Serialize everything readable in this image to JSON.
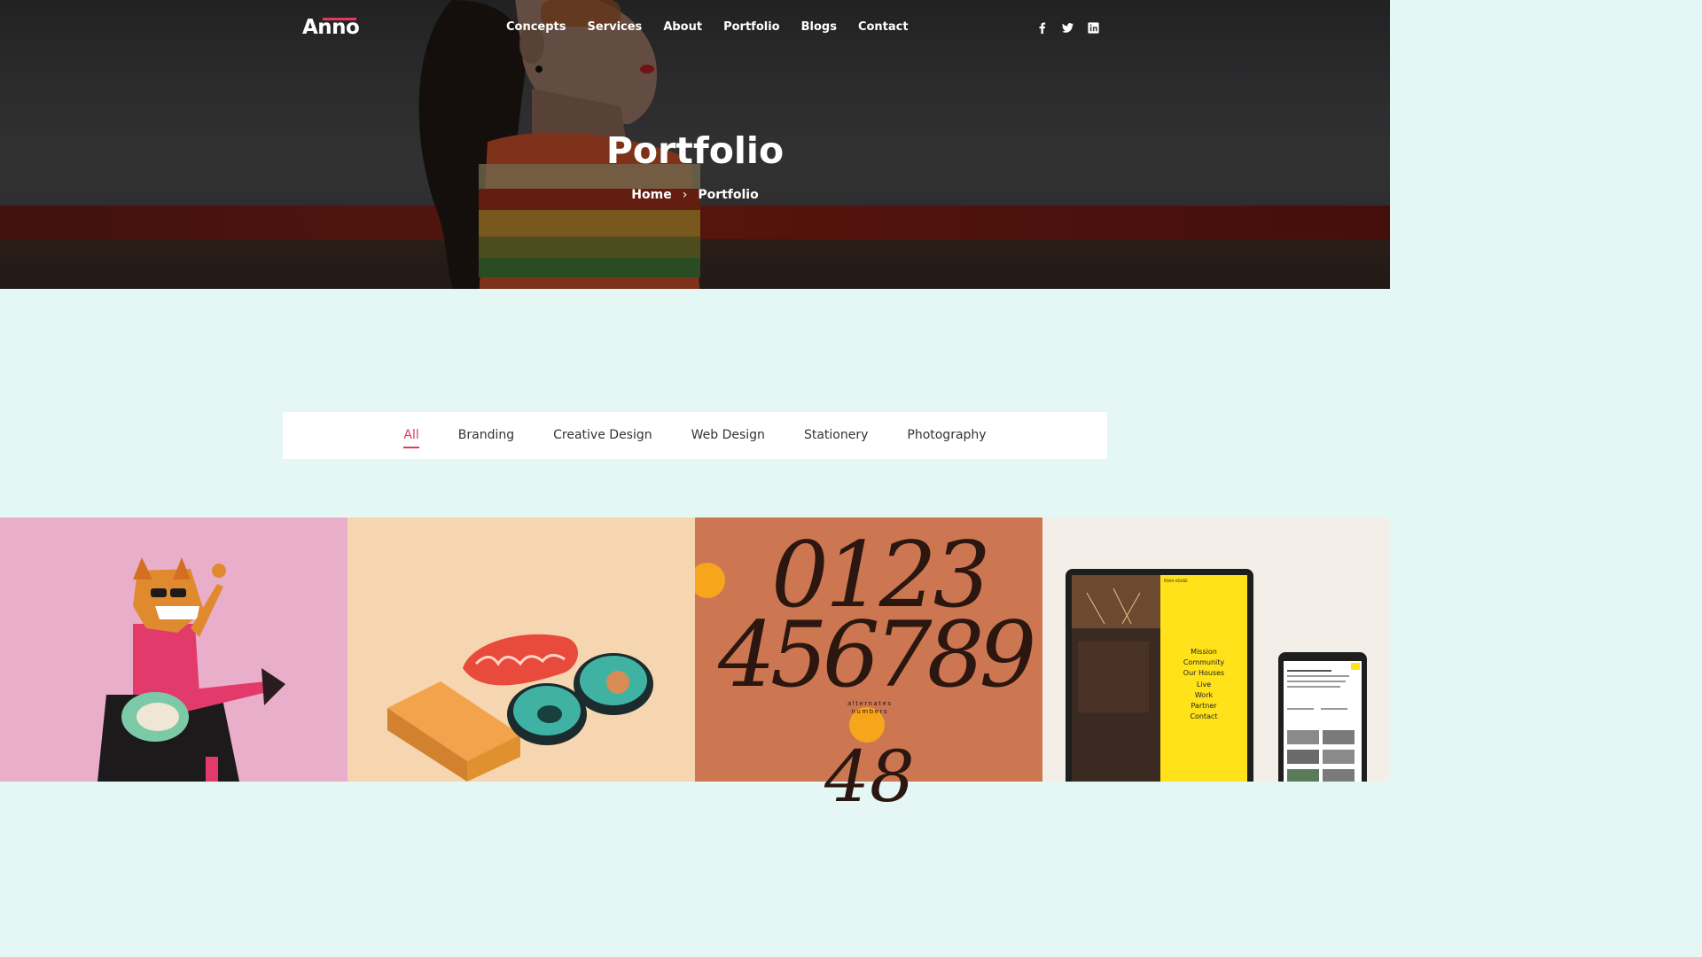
{
  "header": {
    "logo": "Anno",
    "nav": [
      "Concepts",
      "Services",
      "About",
      "Portfolio",
      "Blogs",
      "Contact"
    ],
    "social": [
      "facebook-icon",
      "twitter-icon",
      "linkedin-icon"
    ]
  },
  "hero": {
    "title": "Portfolio",
    "breadcrumb": {
      "home": "Home",
      "separator": "›",
      "current": "Portfolio"
    }
  },
  "filter": {
    "items": [
      "All",
      "Branding",
      "Creative Design",
      "Web Design",
      "Stationery",
      "Photography"
    ],
    "active": "All"
  },
  "portfolio": {
    "tiles": [
      {
        "name": "rocker-character"
      },
      {
        "name": "sushi-avocado"
      },
      {
        "name": "typography-numbers",
        "digits_line1": "0123",
        "digits_line2": "456789",
        "digits_line3": "48",
        "caption_line1": "alternates",
        "caption_line2": "numbers"
      },
      {
        "name": "poha-house-devices",
        "brand": "POHA HOUSE",
        "menu": [
          "Mission",
          "Community",
          "Our Houses",
          "Live",
          "Work",
          "Partner",
          "Contact"
        ]
      }
    ]
  },
  "colors": {
    "accent": "#e8365d",
    "section_bg": "#e4f7f5"
  }
}
